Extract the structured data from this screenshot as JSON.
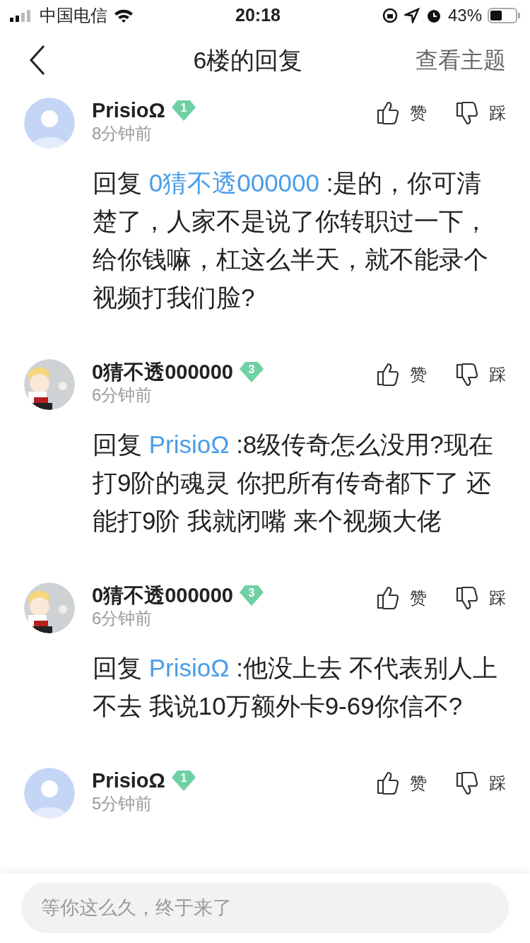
{
  "status_bar": {
    "carrier": "中国电信",
    "time": "20:18",
    "battery": "43%"
  },
  "nav": {
    "title": "6楼的回复",
    "action": "查看主题"
  },
  "comments": [
    {
      "avatar": {
        "kind": "default"
      },
      "name": "PrisioΩ",
      "level": "1",
      "time": "8分钟前",
      "like": "赞",
      "dislike": "踩",
      "reply_prefix": "回复",
      "reply_to": "0猜不透000000",
      "text": ":是的，你可清楚了，人家不是说了你转职过一下，给你钱嘛，杠这么半天，就不能录个视频打我们脸?"
    },
    {
      "name": "0猜不透000000",
      "level": "3",
      "time": "6分钟前",
      "like": "赞",
      "dislike": "踩",
      "reply_prefix": "回复",
      "reply_to": "PrisioΩ",
      "text": ":8级传奇怎么没用?现在打9阶的魂灵 你把所有传奇都下了 还能打9阶 我就闭嘴 来个视频大佬"
    },
    {
      "name": "0猜不透000000",
      "level": "3",
      "time": "6分钟前",
      "like": "赞",
      "dislike": "踩",
      "reply_prefix": "回复",
      "reply_to": "PrisioΩ",
      "text": ":他没上去 不代表别人上不去 我说10万额外卡9-69你信不?"
    },
    {
      "avatar": {
        "kind": "default"
      },
      "name": "PrisioΩ",
      "level": "1",
      "time": "5分钟前",
      "like": "赞",
      "dislike": "踩"
    }
  ],
  "reply_box": {
    "placeholder": "等你这么久，终于来了"
  }
}
